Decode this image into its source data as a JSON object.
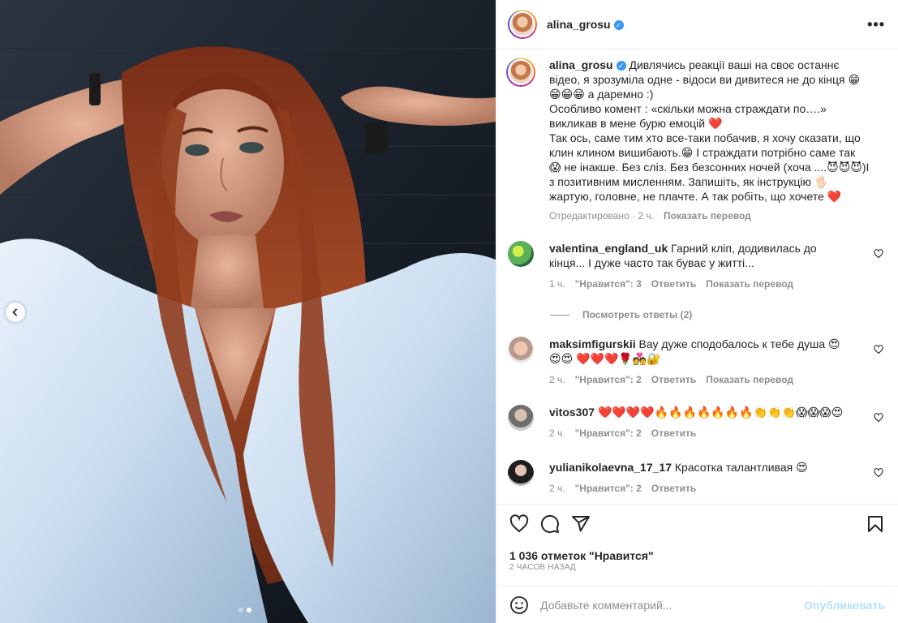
{
  "post": {
    "author": "alina_grosu",
    "verified_mark": "✓",
    "more_glyph": "•••",
    "caption_author": "alina_grosu",
    "caption_lines": [
      "Дивлячись реакції ваші на своє останнє відео, я зрозуміла одне - відоси ви дивитеся не до кінця 😁😁😁😁 а даремно :)",
      "Особливо комент : «скільки можна страждати по….» викликав в мене бурю емоцій ❤️",
      "Так ось, саме тим хто все-таки побачив, я хочу сказати, що клин клином вишибають.😁 І страждати потрібно саме так 😱 не інакше. Без сліз. Без безсонних ночей (хоча ....😈😈😈)І з позитивним мисленням. Запишіть, як інструкцію 🖐🏻 жартую, головне, не плачте. А так робіть, що хочете ❤️"
    ],
    "caption_edited": "Отредактировано",
    "caption_time": "2 ч.",
    "caption_translate": "Показать перевод"
  },
  "comments": [
    {
      "user": "valentina_england_uk",
      "text": "Гарний кліп, додивилась до кінця... І дуже часто так буває у житті...",
      "time": "1 ч.",
      "likes": "\"Нравится\": 3",
      "reply": "Ответить",
      "translate": "Показать перевод",
      "avatar_color": "#6ab04c"
    },
    {
      "user": "maksimfigurskii",
      "text": "Вау дуже сподобалось к тебе душа 😍😍😍 ❤️❤️❤️🌹💑🔐",
      "time": "2 ч.",
      "likes": "\"Нравится\": 2",
      "reply": "Ответить",
      "translate": "Показать перевод",
      "avatar_color": "#c9b8b0"
    },
    {
      "user": "vitos307",
      "text": "❤️❤️❤️❤️🔥🔥🔥🔥🔥🔥🔥👏👏👏😱😱😱😍",
      "time": "2 ч.",
      "likes": "\"Нравится\": 2",
      "reply": "Ответить",
      "avatar_color": "#8a8a8a"
    },
    {
      "user": "yulianikolaevna_17_17",
      "text": "Красотка талантливая 😍",
      "time": "2 ч.",
      "likes": "\"Нравится\": 2",
      "reply": "Ответить",
      "avatar_color": "#2b2b2b"
    }
  ],
  "view_replies": "Посмотреть ответы (2)",
  "likes_count": "1 036 отметок \"Нравится\"",
  "time_ago": "2 ЧАСОВ НАЗАД",
  "add_comment": {
    "placeholder": "Добавьте комментарий...",
    "publish": "Опубликовать"
  }
}
